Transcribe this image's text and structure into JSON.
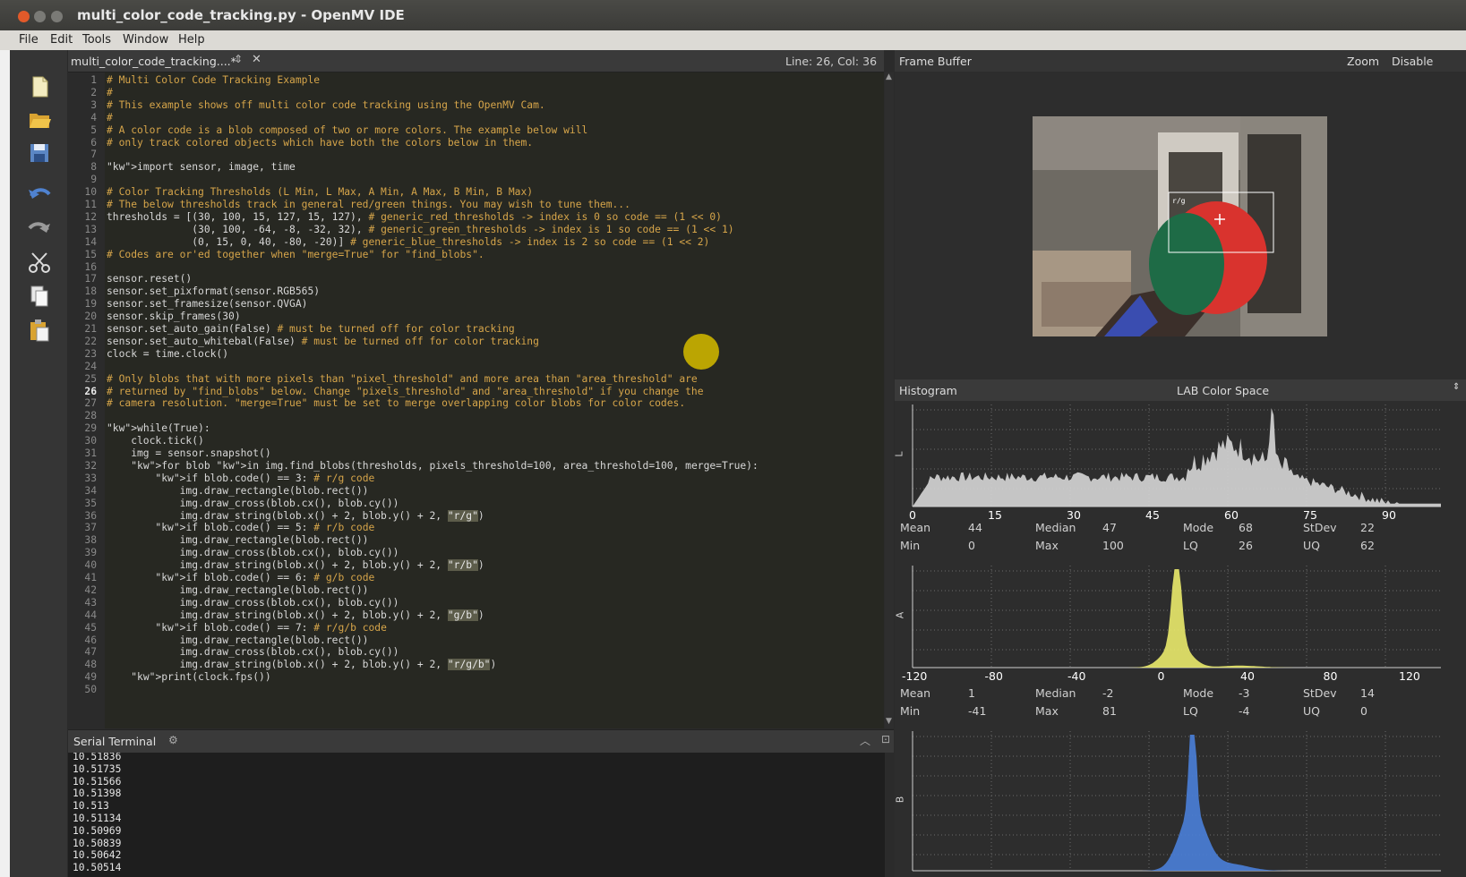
{
  "window": {
    "title": "multi_color_code_tracking.py - OpenMV IDE"
  },
  "menu": [
    "File",
    "Edit",
    "Tools",
    "Window",
    "Help"
  ],
  "toolbar_icons": [
    "new-file-icon",
    "open-folder-icon",
    "save-icon",
    "undo-icon",
    "redo-icon",
    "cut-icon",
    "copy-icon",
    "paste-icon"
  ],
  "editor": {
    "tab_label": "multi_color_code_tracking....*",
    "cursor_pos": "Line: 26, Col: 36",
    "current_line": 26,
    "lines": [
      "# Multi Color Code Tracking Example",
      "#",
      "# This example shows off multi color code tracking using the OpenMV Cam.",
      "#",
      "# A color code is a blob composed of two or more colors. The example below will",
      "# only track colored objects which have both the colors below in them.",
      "",
      "import sensor, image, time",
      "",
      "# Color Tracking Thresholds (L Min, L Max, A Min, A Max, B Min, B Max)",
      "# The below thresholds track in general red/green things. You may wish to tune them...",
      "thresholds = [(30, 100, 15, 127, 15, 127), # generic_red_thresholds -> index is 0 so code == (1 << 0)",
      "              (30, 100, -64, -8, -32, 32), # generic_green_thresholds -> index is 1 so code == (1 << 1)",
      "              (0, 15, 0, 40, -80, -20)] # generic_blue_thresholds -> index is 2 so code == (1 << 2)",
      "# Codes are or'ed together when \"merge=True\" for \"find_blobs\".",
      "",
      "sensor.reset()",
      "sensor.set_pixformat(sensor.RGB565)",
      "sensor.set_framesize(sensor.QVGA)",
      "sensor.skip_frames(30)",
      "sensor.set_auto_gain(False) # must be turned off for color tracking",
      "sensor.set_auto_whitebal(False) # must be turned off for color tracking",
      "clock = time.clock()",
      "",
      "# Only blobs that with more pixels than \"pixel_threshold\" and more area than \"area_threshold\" are",
      "# returned by \"find_blobs\" below. Change \"pixels_threshold\" and \"area_threshold\" if you change the",
      "# camera resolution. \"merge=True\" must be set to merge overlapping color blobs for color codes.",
      "",
      "while(True):",
      "    clock.tick()",
      "    img = sensor.snapshot()",
      "    for blob in img.find_blobs(thresholds, pixels_threshold=100, area_threshold=100, merge=True):",
      "        if blob.code() == 3: # r/g code",
      "            img.draw_rectangle(blob.rect())",
      "            img.draw_cross(blob.cx(), blob.cy())",
      "            img.draw_string(blob.x() + 2, blob.y() + 2, \"r/g\")",
      "        if blob.code() == 5: # r/b code",
      "            img.draw_rectangle(blob.rect())",
      "            img.draw_cross(blob.cx(), blob.cy())",
      "            img.draw_string(blob.x() + 2, blob.y() + 2, \"r/b\")",
      "        if blob.code() == 6: # g/b code",
      "            img.draw_rectangle(blob.rect())",
      "            img.draw_cross(blob.cx(), blob.cy())",
      "            img.draw_string(blob.x() + 2, blob.y() + 2, \"g/b\")",
      "        if blob.code() == 7: # r/g/b code",
      "            img.draw_rectangle(blob.rect())",
      "            img.draw_cross(blob.cx(), blob.cy())",
      "            img.draw_string(blob.x() + 2, blob.y() + 2, \"r/g/b\")",
      "    print(clock.fps())",
      ""
    ]
  },
  "terminal": {
    "title": "Serial Terminal",
    "lines": [
      "10.51836",
      "10.51735",
      "10.51566",
      "10.51398",
      "10.513",
      "10.51134",
      "10.50969",
      "10.50839",
      "10.50642",
      "10.50514"
    ]
  },
  "framebuffer": {
    "title": "Frame Buffer",
    "zoom_label": "Zoom",
    "disable_label": "Disable",
    "blob_label": "r/g"
  },
  "histogram": {
    "title": "Histogram",
    "colorspace": "LAB Color Space",
    "channels": [
      {
        "axis": "L",
        "color": "#d2d2d2",
        "ticks": [
          "0",
          "15",
          "30",
          "45",
          "60",
          "75",
          "90"
        ],
        "stats": {
          "Mean": "44",
          "Median": "47",
          "Mode": "68",
          "StDev": "22",
          "Min": "0",
          "Max": "100",
          "LQ": "26",
          "UQ": "62"
        }
      },
      {
        "axis": "A",
        "color": "#e6e66a",
        "ticks": [
          "-120",
          "-80",
          "-40",
          "0",
          "40",
          "80",
          "120"
        ],
        "stats": {
          "Mean": "1",
          "Median": "-2",
          "Mode": "-3",
          "StDev": "14",
          "Min": "-41",
          "Max": "81",
          "LQ": "-4",
          "UQ": "0"
        }
      },
      {
        "axis": "B",
        "color": "#4a7ed6",
        "ticks": [],
        "stats": {}
      }
    ]
  }
}
